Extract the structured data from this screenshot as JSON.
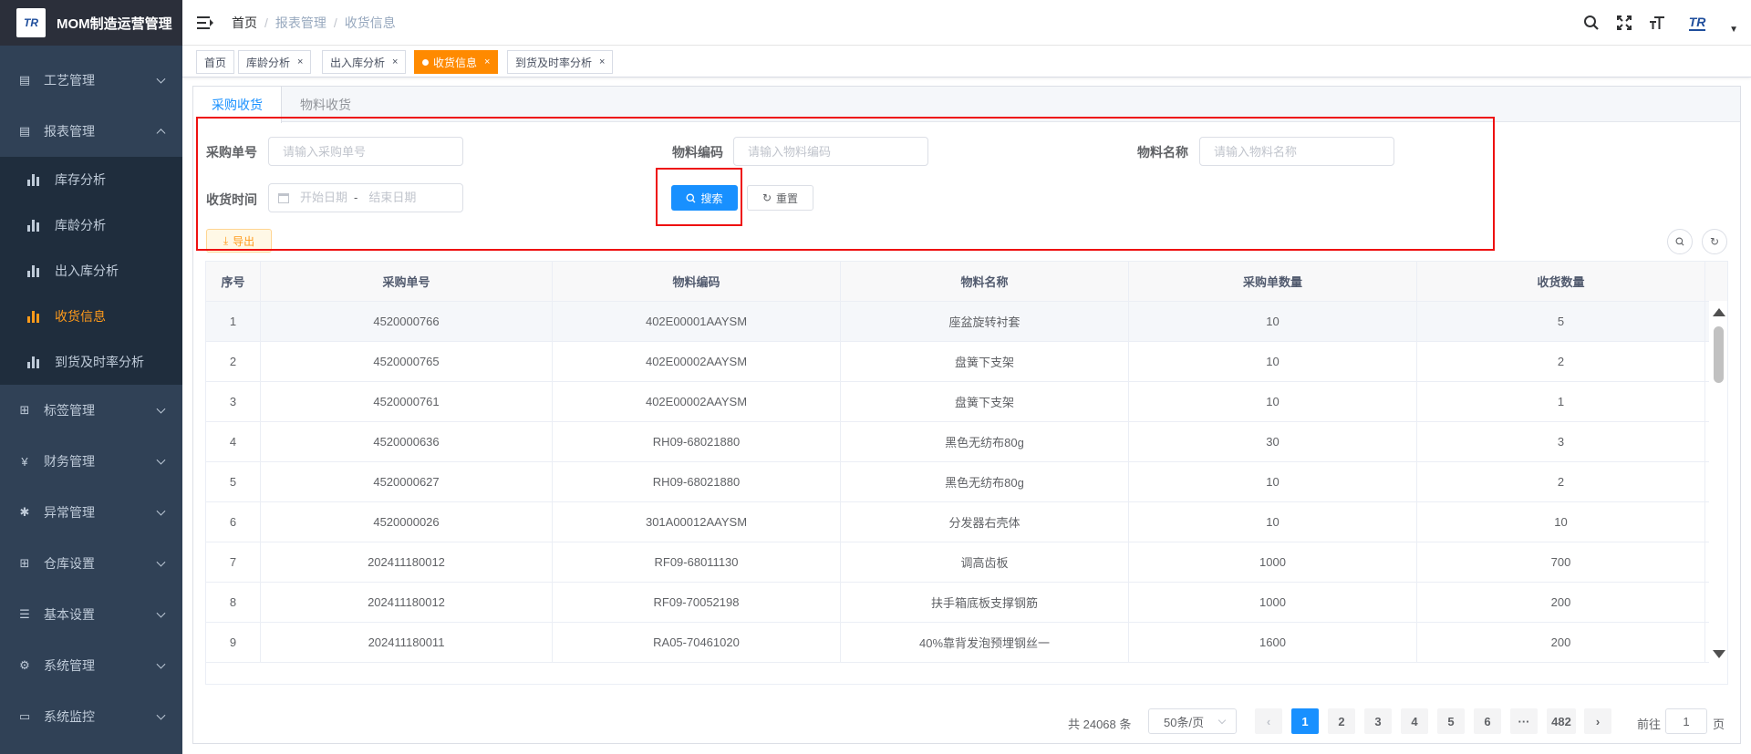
{
  "app": {
    "logo_text": "TR",
    "title": "MOM制造运营管理"
  },
  "sidebar": {
    "items": [
      {
        "label": "工艺管理",
        "icon": "process-icon"
      },
      {
        "label": "报表管理",
        "icon": "report-icon",
        "expanded": true
      },
      {
        "label": "标签管理",
        "icon": "tag-grid-icon"
      },
      {
        "label": "财务管理",
        "icon": "yen-icon"
      },
      {
        "label": "异常管理",
        "icon": "bug-icon"
      },
      {
        "label": "仓库设置",
        "icon": "warehouse-grid-icon"
      },
      {
        "label": "基本设置",
        "icon": "sliders-icon"
      },
      {
        "label": "系统管理",
        "icon": "gear-icon"
      },
      {
        "label": "系统监控",
        "icon": "monitor-icon"
      }
    ],
    "report_children": [
      "库存分析",
      "库龄分析",
      "出入库分析",
      "收货信息",
      "到货及时率分析"
    ],
    "active_child": "收货信息"
  },
  "header": {
    "breadcrumb": [
      "首页",
      "报表管理",
      "收货信息"
    ],
    "avatar_text": "TR"
  },
  "tags": [
    "首页",
    "库龄分析",
    "出入库分析",
    "收货信息",
    "到货及时率分析"
  ],
  "active_tag": "收货信息",
  "tabs": [
    "采购收货",
    "物料收货"
  ],
  "form": {
    "po_label": "采购单号",
    "po_placeholder": "请输入采购单号",
    "code_label": "物料编码",
    "code_placeholder": "请输入物料编码",
    "name_label": "物料名称",
    "name_placeholder": "请输入物料名称",
    "date_label": "收货时间",
    "start_placeholder": "开始日期",
    "range_sep": "-",
    "end_placeholder": "结束日期",
    "search_btn": "搜索",
    "reset_btn": "重置",
    "export_btn": "导出"
  },
  "table": {
    "columns": [
      "序号",
      "采购单号",
      "物料编码",
      "物料名称",
      "采购单数量",
      "收货数量"
    ],
    "rows": [
      [
        "1",
        "4520000766",
        "402E00001AAYSM",
        "座盆旋转衬套",
        "10",
        "5"
      ],
      [
        "2",
        "4520000765",
        "402E00002AAYSM",
        "盘簧下支架",
        "10",
        "2"
      ],
      [
        "3",
        "4520000761",
        "402E00002AAYSM",
        "盘簧下支架",
        "10",
        "1"
      ],
      [
        "4",
        "4520000636",
        "RH09-68021880",
        "黑色无纺布80g",
        "30",
        "3"
      ],
      [
        "5",
        "4520000627",
        "RH09-68021880",
        "黑色无纺布80g",
        "10",
        "2"
      ],
      [
        "6",
        "4520000026",
        "301A00012AAYSM",
        "分发器右壳体",
        "10",
        "10"
      ],
      [
        "7",
        "202411180012",
        "RF09-68011130",
        "调高齿板",
        "1000",
        "700"
      ],
      [
        "8",
        "202411180012",
        "RF09-70052198",
        "扶手箱底板支撑钢筋",
        "1000",
        "200"
      ],
      [
        "9",
        "202411180011",
        "RA05-70461020",
        "40%靠背发泡预埋钢丝一",
        "1600",
        "200"
      ]
    ]
  },
  "pagination": {
    "total_text": "共 24068 条",
    "page_size": "50条/页",
    "pages": [
      "1",
      "2",
      "3",
      "4",
      "5",
      "6"
    ],
    "ellipsis": "···",
    "last_page": "482",
    "goto_prefix": "前往",
    "goto_value": "1",
    "goto_suffix": "页"
  },
  "colors": {
    "accent": "#1890ff",
    "active_tag": "#ff8a00",
    "sidebar_bg": "#304156",
    "highlight": "#ee1111"
  }
}
